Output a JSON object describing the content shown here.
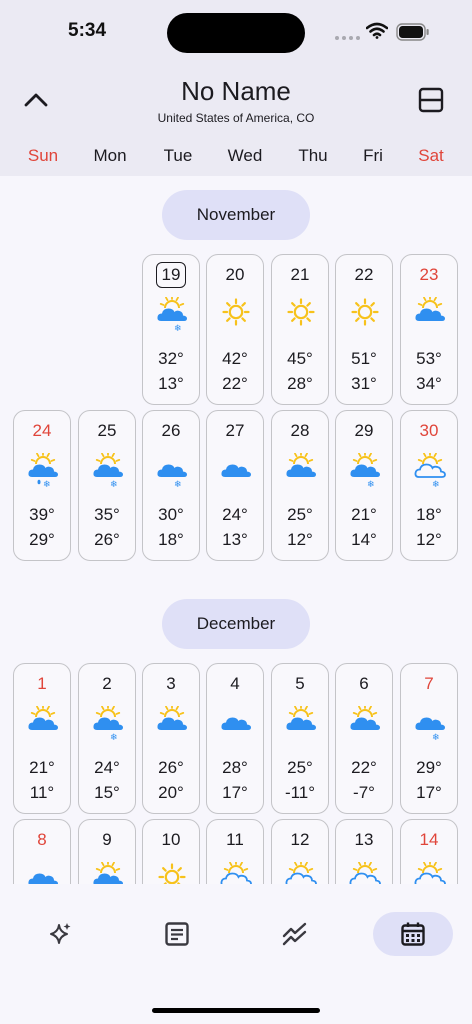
{
  "status": {
    "time": "5:34"
  },
  "header": {
    "title": "No Name",
    "subtitle": "United States of America, CO",
    "weekdays": [
      "Sun",
      "Mon",
      "Tue",
      "Wed",
      "Thu",
      "Fri",
      "Sat"
    ]
  },
  "months": [
    {
      "name": "November",
      "rows": [
        [
          null,
          null,
          {
            "day": "19",
            "icon": "partly-cloudy-snow",
            "high": "32°",
            "low": "13°",
            "today": true
          },
          {
            "day": "20",
            "icon": "sunny",
            "high": "42°",
            "low": "22°"
          },
          {
            "day": "21",
            "icon": "sunny",
            "high": "45°",
            "low": "28°"
          },
          {
            "day": "22",
            "icon": "sunny",
            "high": "51°",
            "low": "31°"
          },
          {
            "day": "23",
            "icon": "partly-cloudy",
            "high": "53°",
            "low": "34°"
          }
        ],
        [
          {
            "day": "24",
            "icon": "partly-cloudy-rain-snow",
            "high": "39°",
            "low": "29°"
          },
          {
            "day": "25",
            "icon": "partly-cloudy-snow",
            "high": "35°",
            "low": "26°"
          },
          {
            "day": "26",
            "icon": "cloudy-snow",
            "high": "30°",
            "low": "18°"
          },
          {
            "day": "27",
            "icon": "cloudy",
            "high": "24°",
            "low": "13°"
          },
          {
            "day": "28",
            "icon": "partly-cloudy",
            "high": "25°",
            "low": "12°"
          },
          {
            "day": "29",
            "icon": "partly-cloudy-snow",
            "high": "21°",
            "low": "14°"
          },
          {
            "day": "30",
            "icon": "partly-cloudy-outline-snow",
            "high": "18°",
            "low": "12°"
          }
        ]
      ]
    },
    {
      "name": "December",
      "rows": [
        [
          {
            "day": "1",
            "icon": "partly-cloudy",
            "high": "21°",
            "low": "11°"
          },
          {
            "day": "2",
            "icon": "partly-cloudy-snow",
            "high": "24°",
            "low": "15°"
          },
          {
            "day": "3",
            "icon": "partly-cloudy",
            "high": "26°",
            "low": "20°"
          },
          {
            "day": "4",
            "icon": "cloudy",
            "high": "28°",
            "low": "17°"
          },
          {
            "day": "5",
            "icon": "partly-cloudy",
            "high": "25°",
            "low": "-11°"
          },
          {
            "day": "6",
            "icon": "partly-cloudy",
            "high": "22°",
            "low": "-7°"
          },
          {
            "day": "7",
            "icon": "cloudy-snow",
            "high": "29°",
            "low": "17°"
          }
        ],
        [
          {
            "day": "8",
            "icon": "cloudy",
            "high": "",
            "low": ""
          },
          {
            "day": "9",
            "icon": "partly-cloudy",
            "high": "",
            "low": ""
          },
          {
            "day": "10",
            "icon": "sunny",
            "high": "",
            "low": ""
          },
          {
            "day": "11",
            "icon": "partly-cloudy-outline",
            "high": "",
            "low": ""
          },
          {
            "day": "12",
            "icon": "partly-cloudy-outline",
            "high": "",
            "low": ""
          },
          {
            "day": "13",
            "icon": "partly-cloudy-outline",
            "high": "",
            "low": ""
          },
          {
            "day": "14",
            "icon": "partly-cloudy-outline",
            "high": "",
            "low": ""
          }
        ]
      ]
    }
  ],
  "nav": {
    "items": [
      {
        "id": "sparkle",
        "icon": "sparkle-icon"
      },
      {
        "id": "notes",
        "icon": "document-icon"
      },
      {
        "id": "trends",
        "icon": "trend-icon"
      },
      {
        "id": "calendar",
        "icon": "calendar-icon",
        "active": true
      }
    ]
  },
  "colors": {
    "accent": "#dfe0f7",
    "weekend": "#e0453a",
    "sun": "#f7c21b",
    "cloud": "#2f8ff0"
  }
}
